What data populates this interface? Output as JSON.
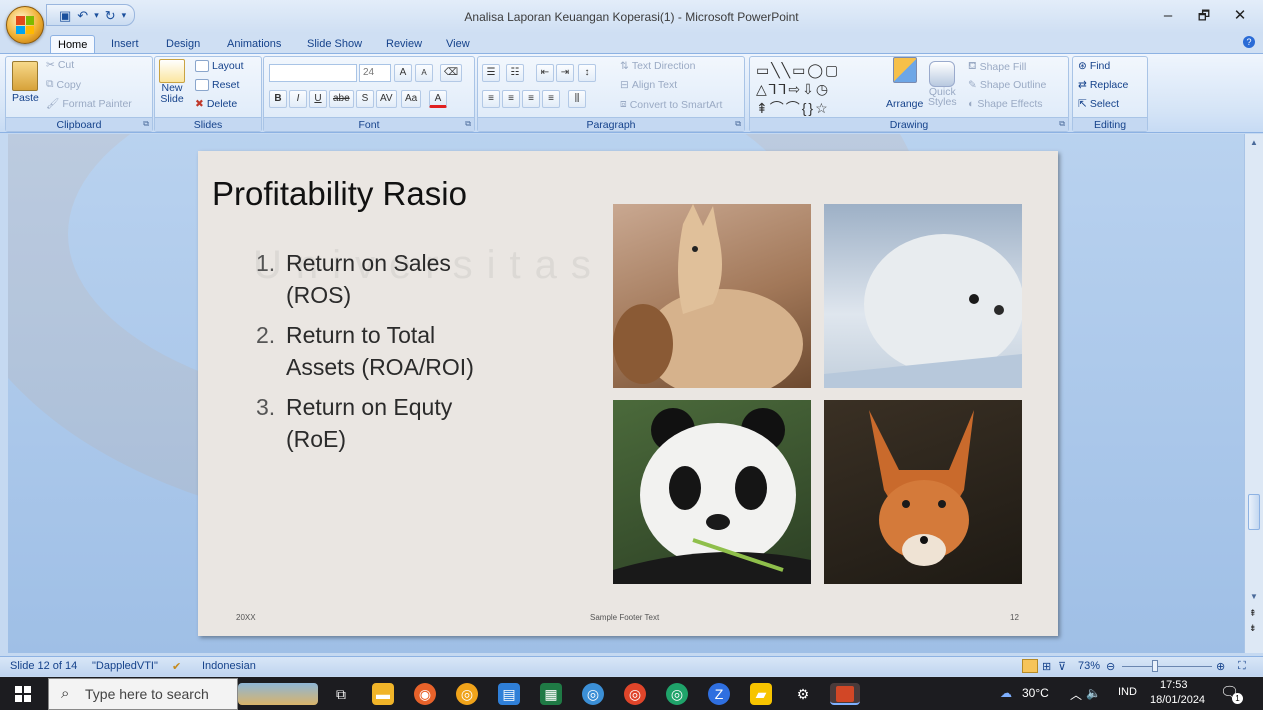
{
  "window": {
    "title": "Analisa Laporan Keuangan Koperasi(1) - Microsoft PowerPoint",
    "minimize": "–",
    "restore": "🗗",
    "close": "✕"
  },
  "ribbon_tabs": [
    "Home",
    "Insert",
    "Design",
    "Animations",
    "Slide Show",
    "Review",
    "View"
  ],
  "ribbon": {
    "clipboard": {
      "label": "Clipboard",
      "paste": "Paste",
      "cut": "Cut",
      "copy": "Copy",
      "format_painter": "Format Painter"
    },
    "slides": {
      "label": "Slides",
      "new_slide_1": "New",
      "new_slide_2": "Slide",
      "layout": "Layout",
      "reset": "Reset",
      "delete": "Delete"
    },
    "font": {
      "label": "Font",
      "size": "24",
      "bold": "B",
      "italic": "I",
      "underline": "U",
      "strike": "abe",
      "shadow": "S",
      "spacing": "AV",
      "case": "Aa",
      "grow": "A",
      "shrink": "A",
      "color": "A"
    },
    "paragraph": {
      "label": "Paragraph",
      "text_direction": "Text Direction",
      "align_text": "Align Text",
      "convert_smartart": "Convert to SmartArt"
    },
    "drawing": {
      "label": "Drawing",
      "arrange": "Arrange",
      "quick_styles_1": "Quick",
      "quick_styles_2": "Styles",
      "shape_fill": "Shape Fill",
      "shape_outline": "Shape Outline",
      "shape_effects": "Shape Effects"
    },
    "editing": {
      "label": "Editing",
      "find": "Find",
      "replace": "Replace",
      "select": "Select"
    }
  },
  "slide": {
    "title": "Profitability Rasio",
    "watermark": "Universitas",
    "items": [
      {
        "num": "1.",
        "line1": "Return on Sales",
        "line2": "(ROS)"
      },
      {
        "num": "2.",
        "line1": "Return to Total",
        "line2": "Assets (ROA/ROI)"
      },
      {
        "num": "3.",
        "line1": "Return on Equty",
        "line2": "(RoE)"
      }
    ],
    "footer_left": "20XX",
    "footer_center": "Sample Footer Text",
    "footer_right": "12",
    "photos": [
      "llama-photo",
      "seal-photo",
      "panda-photo",
      "fox-photo"
    ]
  },
  "statusbar": {
    "slide_count": "Slide 12 of 14",
    "theme": "\"DappledVTI\"",
    "language": "Indonesian",
    "zoom": "73%"
  },
  "taskbar": {
    "search_placeholder": "Type here to search",
    "weather": "30°C",
    "language": "IND",
    "time": "17:53",
    "date": "18/01/2024",
    "notification_count": "1"
  },
  "colors": {
    "ribbon_text": "#15428b",
    "slide_bg": "#eae6e2",
    "workspace_bg": "#a9c6ea",
    "taskbar_bg": "#1c1c20"
  }
}
